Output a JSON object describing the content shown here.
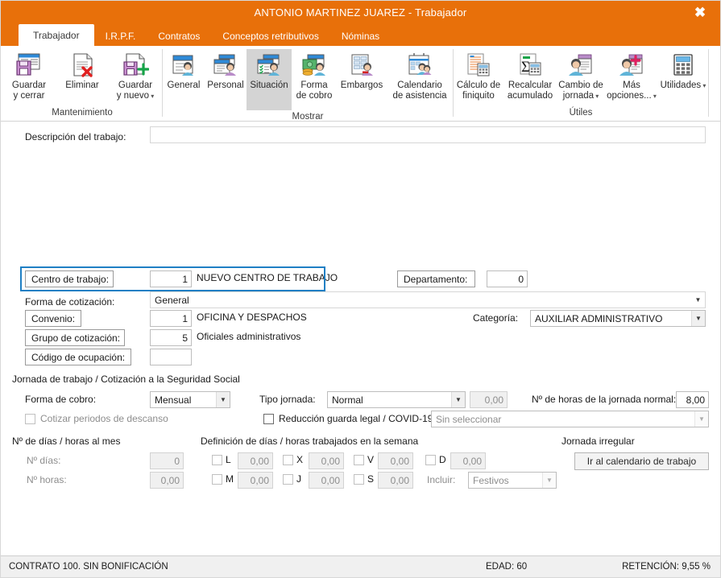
{
  "window": {
    "title": "ANTONIO MARTINEZ JUAREZ - Trabajador",
    "close_label": "✖",
    "accent_color": "#e8700a"
  },
  "tabs": [
    {
      "label": "Trabajador",
      "active": true
    },
    {
      "label": "I.R.P.F.",
      "active": false
    },
    {
      "label": "Contratos",
      "active": false
    },
    {
      "label": "Conceptos retributivos",
      "active": false
    },
    {
      "label": "Nóminas",
      "active": false
    }
  ],
  "ribbon": {
    "groups": [
      {
        "name": "Mantenimiento",
        "label": "Mantenimiento",
        "buttons": [
          {
            "label": "Guardar\ny cerrar",
            "icon": "save-close-icon",
            "dropdown": false,
            "selected": false
          },
          {
            "label": "Eliminar",
            "icon": "delete-document-icon",
            "dropdown": false,
            "selected": false
          },
          {
            "label": "Guardar\ny nuevo",
            "icon": "save-new-icon",
            "dropdown": true,
            "selected": false
          }
        ]
      },
      {
        "name": "Mostrar",
        "label": "Mostrar",
        "buttons": [
          {
            "label": "General",
            "icon": "general-person-icon",
            "dropdown": false,
            "selected": false
          },
          {
            "label": "Personal",
            "icon": "personal-person-icon",
            "dropdown": false,
            "selected": false
          },
          {
            "label": "Situación",
            "icon": "situation-person-icon",
            "dropdown": false,
            "selected": true
          },
          {
            "label": "Forma\nde cobro",
            "icon": "payment-money-icon",
            "dropdown": false,
            "selected": false
          },
          {
            "label": "Embargos",
            "icon": "garnishment-icon",
            "dropdown": false,
            "selected": false
          },
          {
            "label": "Calendario\nde asistencia",
            "icon": "calendar-attendance-icon",
            "dropdown": false,
            "selected": false
          }
        ]
      },
      {
        "name": "Utiles",
        "label": "Útiles",
        "buttons": [
          {
            "label": "Cálculo de\nfiniquito",
            "icon": "settlement-calc-icon",
            "dropdown": false,
            "selected": false
          },
          {
            "label": "Recalcular\nacumulado",
            "icon": "sigma-recalc-icon",
            "dropdown": false,
            "selected": false
          },
          {
            "label": "Cambio de\njornada",
            "icon": "workday-change-icon",
            "dropdown": true,
            "selected": false
          },
          {
            "label": "Más\nopciones...",
            "icon": "more-options-icon",
            "dropdown": true,
            "selected": false
          },
          {
            "label": "Utilidades",
            "icon": "calculator-icon",
            "dropdown": true,
            "selected": false
          }
        ]
      }
    ]
  },
  "form": {
    "descripcion_label": "Descripción del trabajo:",
    "descripcion_value": "",
    "centro_label": "Centro de trabajo:",
    "centro_code": "1",
    "centro_name": "NUEVO CENTRO DE TRABAJO",
    "departamento_label": "Departamento:",
    "departamento_value": "0",
    "forma_cotizacion_label": "Forma de cotización:",
    "forma_cotizacion_value": "General",
    "convenio_label": "Convenio:",
    "convenio_code": "1",
    "convenio_name": "OFICINA Y DESPACHOS",
    "categoria_label": "Categoría:",
    "categoria_value": "AUXILIAR ADMINISTRATIVO",
    "grupo_label": "Grupo de cotización:",
    "grupo_code": "5",
    "grupo_name": "Oficiales administrativos",
    "ocupacion_label": "Código de ocupación:",
    "ocupacion_value": "",
    "highlight_color": "#1f7fc4"
  },
  "jornada": {
    "section_title": "Jornada de trabajo / Cotización a la Seguridad Social",
    "forma_cobro_label": "Forma de cobro:",
    "forma_cobro_value": "Mensual",
    "cotizar_descanso_label": "Cotizar periodos de descanso",
    "cotizar_descanso_checked": false,
    "tipo_jornada_label": "Tipo jornada:",
    "tipo_jornada_value": "Normal",
    "tipo_jornada_num": "0,00",
    "horas_normal_label": "Nº de horas de la jornada normal:",
    "horas_normal_value": "8,00",
    "reduccion_label": "Reducción guarda legal / COVID-19",
    "reduccion_checked": false,
    "reduccion_select_value": "Sin seleccionar"
  },
  "mes": {
    "section_title": "Nº de días / horas al mes",
    "dias_label": "Nº días:",
    "dias_value": "0",
    "horas_label": "Nº horas:",
    "horas_value": "0,00"
  },
  "semana": {
    "section_title": "Definición de días / horas trabajados en la semana",
    "days": [
      {
        "code": "L",
        "value": "0,00",
        "checked": false
      },
      {
        "code": "M",
        "value": "0,00",
        "checked": false
      },
      {
        "code": "X",
        "value": "0,00",
        "checked": false
      },
      {
        "code": "J",
        "value": "0,00",
        "checked": false
      },
      {
        "code": "V",
        "value": "0,00",
        "checked": false
      },
      {
        "code": "S",
        "value": "0,00",
        "checked": false
      },
      {
        "code": "D",
        "value": "0,00",
        "checked": false
      }
    ],
    "incluir_label": "Incluir:",
    "incluir_value": "Festivos"
  },
  "irregular": {
    "section_title": "Jornada irregular",
    "button_label": "Ir al calendario de trabajo"
  },
  "statusbar": {
    "contrato": "CONTRATO 100.  SIN BONIFICACIÓN",
    "edad": "EDAD: 60",
    "retencion": "RETENCIÓN: 9,55 %"
  }
}
